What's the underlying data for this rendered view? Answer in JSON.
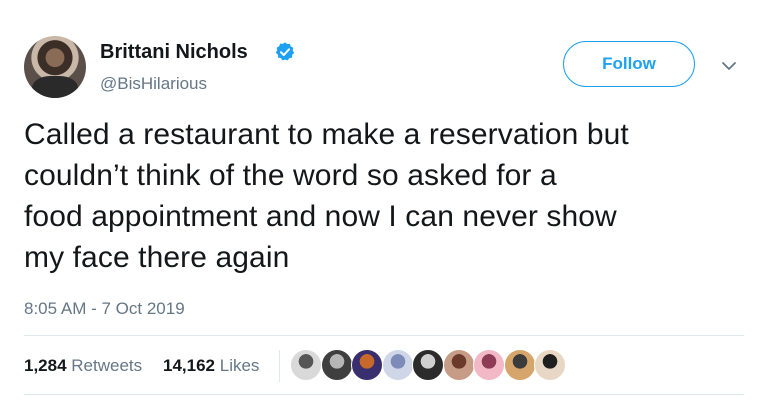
{
  "user": {
    "display_name": "Brittani Nichols",
    "handle": "@BisHilarious",
    "verified_color": "#1da1f2"
  },
  "actions": {
    "follow_label": "Follow",
    "more_icon": "chevron-down-icon"
  },
  "tweet": {
    "text": "Called a restaurant to make a reservation but\ncouldn’t think of the word so asked for a\nfood appointment and now I can never show\nmy face there again",
    "timestamp": "8:05 AM - 7 Oct 2019"
  },
  "stats": {
    "retweets_count": "1,284",
    "retweets_label": "Retweets",
    "likes_count": "14,162",
    "likes_label": "Likes"
  },
  "likers": [
    {
      "avatar_colors": [
        "#d9d9d9",
        "#555555"
      ]
    },
    {
      "avatar_colors": [
        "#3f3f3f",
        "#b6b6b6"
      ]
    },
    {
      "avatar_colors": [
        "#3a2f6e",
        "#c7692b"
      ]
    },
    {
      "avatar_colors": [
        "#cfd6e8",
        "#7d8bb8"
      ]
    },
    {
      "avatar_colors": [
        "#2b2b2b",
        "#cfcfcf"
      ]
    },
    {
      "avatar_colors": [
        "#c79c86",
        "#6b3a2a"
      ]
    },
    {
      "avatar_colors": [
        "#f3b8c6",
        "#8e3b55"
      ]
    },
    {
      "avatar_colors": [
        "#d6a56b",
        "#3b3b3b"
      ]
    },
    {
      "avatar_colors": [
        "#e8d7c4",
        "#1f1f1f"
      ]
    }
  ],
  "colors": {
    "accent": "#1da1f2",
    "secondary_text": "#657786",
    "divider": "#e1e8ed"
  }
}
